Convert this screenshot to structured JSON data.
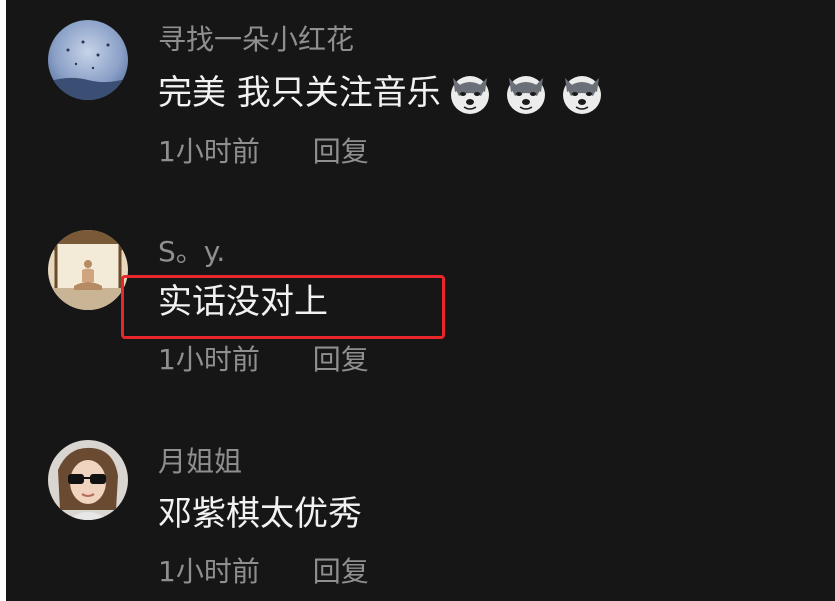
{
  "comments": [
    {
      "username": "寻找一朵小红花",
      "text": "完美 我只关注音乐",
      "emojis": [
        "husky-emoji",
        "husky-emoji",
        "husky-emoji"
      ],
      "time": "1小时前",
      "reply_label": "回复",
      "avatar": "night-sky-avatar"
    },
    {
      "username": "S。y.",
      "text": "实话没对上",
      "emojis": [],
      "time": "1小时前",
      "reply_label": "回复",
      "avatar": "meditation-avatar"
    },
    {
      "username": "月姐姐",
      "text": "邓紫棋太优秀",
      "emojis": [],
      "time": "1小时前",
      "reply_label": "回复",
      "avatar": "woman-sunglasses-avatar"
    }
  ],
  "highlight_color": "#e8262b",
  "background_color": "#161616"
}
